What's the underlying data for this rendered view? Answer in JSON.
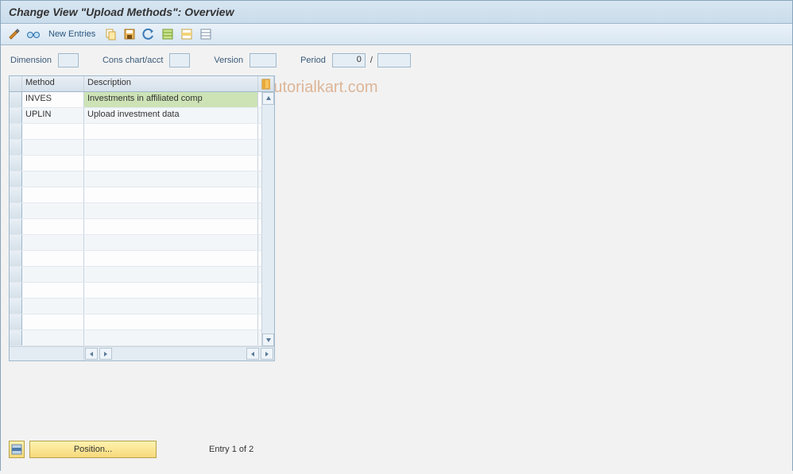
{
  "title": "Change View \"Upload Methods\": Overview",
  "toolbar": {
    "new_entries": "New Entries"
  },
  "filters": {
    "dimension_label": "Dimension",
    "cons_label": "Cons chart/acct",
    "version_label": "Version",
    "period_label": "Period",
    "period_value": "0",
    "period_sep": "/"
  },
  "table": {
    "headers": {
      "method": "Method",
      "description": "Description"
    },
    "rows": [
      {
        "method": "INVES",
        "description": "Investments in affiliated comp"
      },
      {
        "method": "UPLIN",
        "description": "Upload investment data"
      }
    ]
  },
  "footer": {
    "position_label": "Position...",
    "entry_text": "Entry 1 of 2"
  },
  "watermark": "www.tutorialkart.com"
}
